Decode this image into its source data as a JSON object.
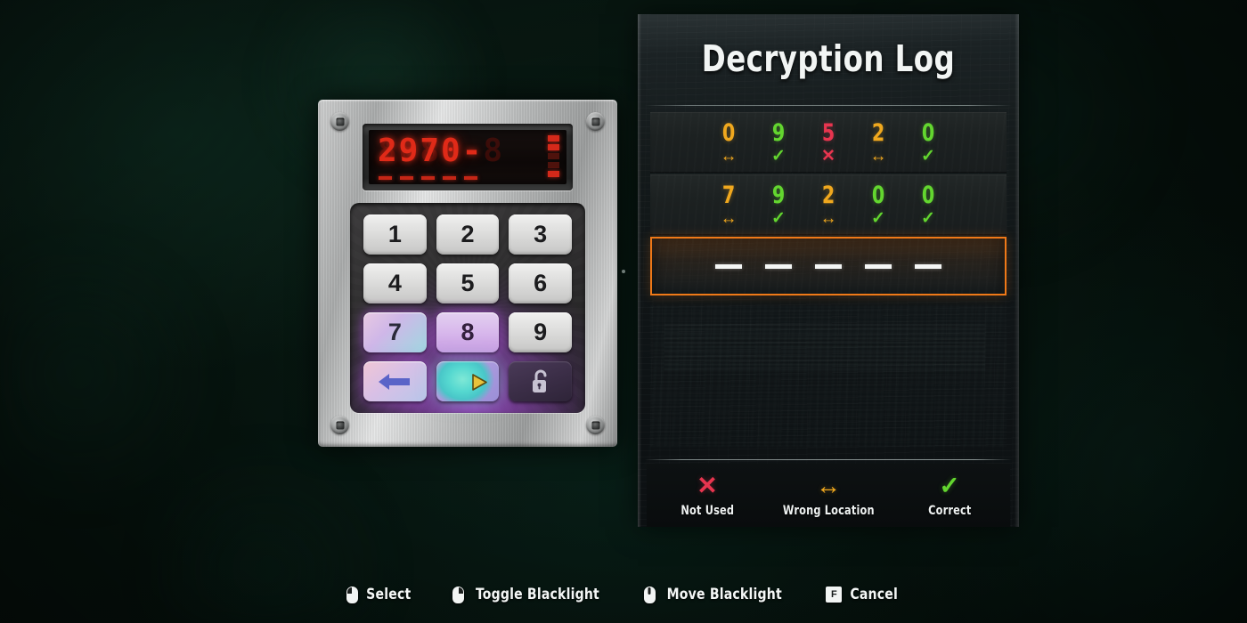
{
  "scene": {
    "background_color": "#07150f",
    "accent_orange": "#ef7918"
  },
  "keypad": {
    "display": {
      "code": "2970-",
      "ghost_code": "8888-8",
      "sub_dashes": 5,
      "bars": 5
    },
    "keys": [
      {
        "label": "1",
        "name": "keypad-key-1",
        "state": "normal"
      },
      {
        "label": "2",
        "name": "keypad-key-2",
        "state": "normal"
      },
      {
        "label": "3",
        "name": "keypad-key-3",
        "state": "normal"
      },
      {
        "label": "4",
        "name": "keypad-key-4",
        "state": "normal"
      },
      {
        "label": "5",
        "name": "keypad-key-5",
        "state": "normal"
      },
      {
        "label": "6",
        "name": "keypad-key-6",
        "state": "normal"
      },
      {
        "label": "7",
        "name": "keypad-key-7",
        "state": "uv-lit"
      },
      {
        "label": "8",
        "name": "keypad-key-8",
        "state": "uv-lit"
      },
      {
        "label": "9",
        "name": "keypad-key-9",
        "state": "normal"
      }
    ],
    "function_keys": [
      {
        "icon": "back-arrow-icon",
        "name": "keypad-backspace-key"
      },
      {
        "icon": "blacklight-smudge-icon",
        "name": "keypad-blacklight-key"
      },
      {
        "icon": "unlocked-padlock-icon",
        "name": "keypad-unlock-key"
      }
    ]
  },
  "log": {
    "title": "Decryption Log",
    "rows": [
      {
        "cells": [
          {
            "digit": "0",
            "status": "wrong"
          },
          {
            "digit": "9",
            "status": "correct"
          },
          {
            "digit": "5",
            "status": "notused"
          },
          {
            "digit": "2",
            "status": "wrong"
          },
          {
            "digit": "0",
            "status": "correct"
          }
        ]
      },
      {
        "cells": [
          {
            "digit": "7",
            "status": "wrong"
          },
          {
            "digit": "9",
            "status": "correct"
          },
          {
            "digit": "2",
            "status": "wrong"
          },
          {
            "digit": "0",
            "status": "correct"
          },
          {
            "digit": "0",
            "status": "correct"
          }
        ]
      }
    ],
    "active_row": {
      "slots": 5,
      "entered": [
        "",
        "",
        "",
        "",
        ""
      ]
    },
    "marks": {
      "correct": "✓",
      "wrong": "↔",
      "notused": "✕"
    },
    "legend": [
      {
        "glyph": "✕",
        "label": "Not Used",
        "status": "notused",
        "color": "#e8354f"
      },
      {
        "glyph": "↔",
        "label": "Wrong Location",
        "status": "wrong",
        "color": "#f0a81e"
      },
      {
        "glyph": "✓",
        "label": "Correct",
        "status": "correct",
        "color": "#63d62f"
      }
    ]
  },
  "controls": [
    {
      "input": "mouse-left",
      "label": "Select"
    },
    {
      "input": "mouse-right",
      "label": "Toggle Blacklight"
    },
    {
      "input": "mouse-middle",
      "label": "Move Blacklight"
    },
    {
      "input": "key-f",
      "key_label": "F",
      "label": "Cancel"
    }
  ]
}
